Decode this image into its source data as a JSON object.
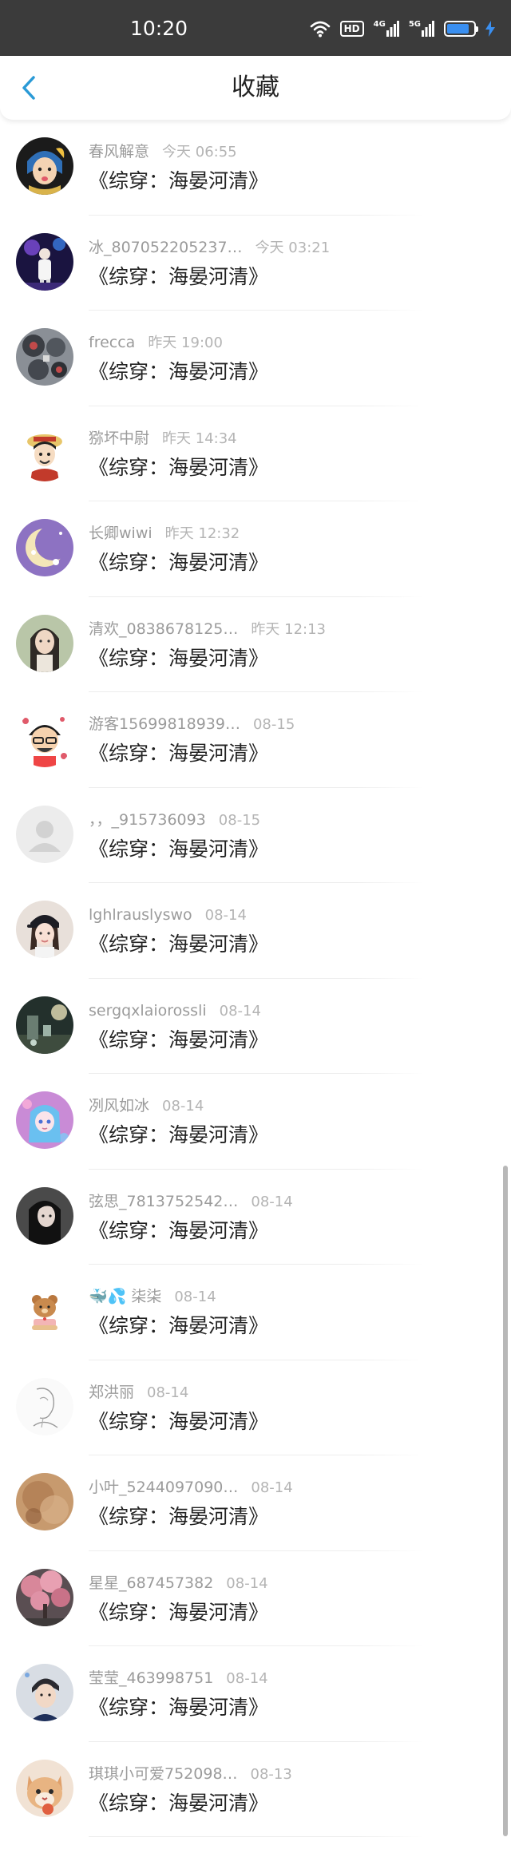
{
  "status_bar": {
    "time": "10:20",
    "hd": "HD",
    "net1": "4G",
    "net2": "5G",
    "battery_level": 0.85,
    "battery_color": "#3a8ff0"
  },
  "header": {
    "title": "收藏",
    "back_icon": "chevron-left-icon",
    "accent": "#2a9ad6"
  },
  "items": [
    {
      "name": "春风解意",
      "time": "今天 06:55",
      "book": "《综穿：海晏河清》"
    },
    {
      "name": "冰_807052205237…",
      "time": "今天 03:21",
      "book": "《综穿：海晏河清》"
    },
    {
      "name": "frecca",
      "time": "昨天 19:00",
      "book": "《综穿：海晏河清》"
    },
    {
      "name": "猕坏中尉",
      "time": "昨天 14:34",
      "book": "《综穿：海晏河清》"
    },
    {
      "name": "长卿wiwi",
      "time": "昨天 12:32",
      "book": "《综穿：海晏河清》"
    },
    {
      "name": "清欢_0838678125…",
      "time": "昨天 12:13",
      "book": "《综穿：海晏河清》"
    },
    {
      "name": "游客15699818939…",
      "time": "08-15",
      "book": "《综穿：海晏河清》"
    },
    {
      "name": "，，_915736093",
      "time": "08-15",
      "book": "《综穿：海晏河清》"
    },
    {
      "name": "lghlrauslyswo",
      "time": "08-14",
      "book": "《综穿：海晏河清》"
    },
    {
      "name": "sergqxlaiorossli",
      "time": "08-14",
      "book": "《综穿：海晏河清》"
    },
    {
      "name": "冽风如冰",
      "time": "08-14",
      "book": "《综穿：海晏河清》"
    },
    {
      "name": "弦思_7813752542…",
      "time": "08-14",
      "book": "《综穿：海晏河清》"
    },
    {
      "name": "🐳💦 柒柒",
      "time": "08-14",
      "book": "《综穿：海晏河清》"
    },
    {
      "name": "郑洪丽",
      "time": "08-14",
      "book": "《综穿：海晏河清》"
    },
    {
      "name": "小叶_5244097090…",
      "time": "08-14",
      "book": "《综穿：海晏河清》"
    },
    {
      "name": "星星_687457382",
      "time": "08-14",
      "book": "《综穿：海晏河清》"
    },
    {
      "name": "莹莹_463998751",
      "time": "08-14",
      "book": "《综穿：海晏河清》"
    },
    {
      "name": "琪琪小可爱752098…",
      "time": "08-13",
      "book": "《综穿：海晏河清》"
    }
  ]
}
